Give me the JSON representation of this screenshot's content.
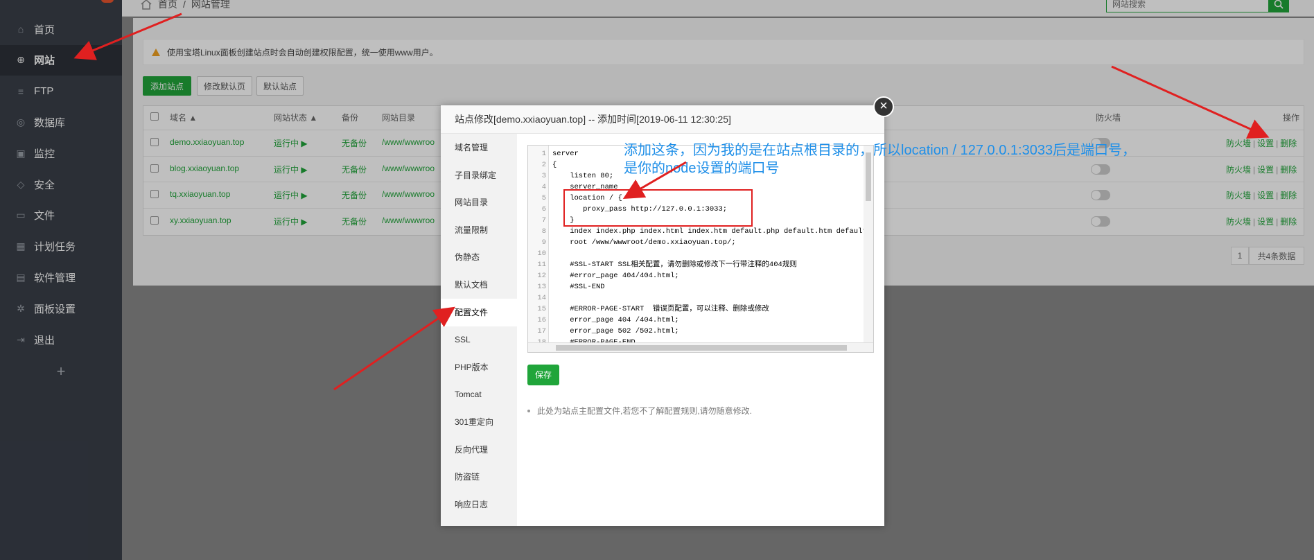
{
  "sidebar": {
    "items": [
      {
        "label": "首页",
        "icon": "home-icon"
      },
      {
        "label": "网站",
        "icon": "globe-icon"
      },
      {
        "label": "FTP",
        "icon": "ftp-icon"
      },
      {
        "label": "数据库",
        "icon": "database-icon"
      },
      {
        "label": "监控",
        "icon": "monitor-icon"
      },
      {
        "label": "安全",
        "icon": "shield-icon"
      },
      {
        "label": "文件",
        "icon": "folder-icon"
      },
      {
        "label": "计划任务",
        "icon": "calendar-icon"
      },
      {
        "label": "软件管理",
        "icon": "apps-icon"
      },
      {
        "label": "面板设置",
        "icon": "gear-icon"
      },
      {
        "label": "退出",
        "icon": "logout-icon"
      }
    ],
    "add_label": "+"
  },
  "breadcrumb": {
    "home": "首页",
    "sep": "/",
    "current": "网站管理"
  },
  "search": {
    "placeholder": "网站搜索"
  },
  "alert": {
    "text": "使用宝塔Linux面板创建站点时会自动创建权限配置，统一使用www用户。"
  },
  "toolbar": {
    "add_site": "添加站点",
    "edit_default": "修改默认页",
    "default_site": "默认站点"
  },
  "table": {
    "headers": {
      "domain": "域名 ▲",
      "status": "网站状态 ▲",
      "backup": "备份",
      "dir": "网站目录",
      "firewall": "防火墙",
      "ops": "操作"
    },
    "rows": [
      {
        "domain": "demo.xxiaoyuan.top",
        "status": "运行中 ▶",
        "backup": "无备份",
        "dir": "/www/wwwroo"
      },
      {
        "domain": "blog.xxiaoyuan.top",
        "status": "运行中 ▶",
        "backup": "无备份",
        "dir": "/www/wwwroo"
      },
      {
        "domain": "tq.xxiaoyuan.top",
        "status": "运行中 ▶",
        "backup": "无备份",
        "dir": "/www/wwwroo"
      },
      {
        "domain": "xy.xxiaoyuan.top",
        "status": "运行中 ▶",
        "backup": "无备份",
        "dir": "/www/wwwroo"
      }
    ],
    "ops": {
      "firewall": "防火墙",
      "settings": "设置",
      "delete": "删除",
      "sep": "|"
    }
  },
  "pagination": {
    "page": "1",
    "total": "共4条数据"
  },
  "modal": {
    "title": "站点修改[demo.xxiaoyuan.top] -- 添加时间[2019-06-11 12:30:25]",
    "close": "×",
    "nav": [
      "域名管理",
      "子目录绑定",
      "网站目录",
      "流量限制",
      "伪静态",
      "默认文档",
      "配置文件",
      "SSL",
      "PHP版本",
      "Tomcat",
      "301重定向",
      "反向代理",
      "防盗链",
      "响应日志"
    ],
    "active_nav": "配置文件",
    "save_label": "保存",
    "note": "此处为站点主配置文件,若您不了解配置规则,请勿随意修改."
  },
  "editor": {
    "lines": [
      {
        "n": "1",
        "text": "server"
      },
      {
        "n": "2",
        "text": "{"
      },
      {
        "n": "3",
        "text": "    listen 80;"
      },
      {
        "n": "4",
        "text": "    server_name"
      },
      {
        "n": "5",
        "text": "    location / {"
      },
      {
        "n": "6",
        "text": "       proxy_pass http://127.0.0.1:3033;"
      },
      {
        "n": "7",
        "text": "    }"
      },
      {
        "n": "8",
        "text": "    index index.php index.html index.htm default.php default.htm default.ht"
      },
      {
        "n": "9",
        "text": "    root /www/wwwroot/demo.xxiaoyuan.top/;"
      },
      {
        "n": "10",
        "text": ""
      },
      {
        "n": "11",
        "text": "    #SSL-START SSL相关配置，请勿删除或修改下一行带注释的404规则"
      },
      {
        "n": "12",
        "text": "    #error_page 404/404.html;"
      },
      {
        "n": "13",
        "text": "    #SSL-END"
      },
      {
        "n": "14",
        "text": ""
      },
      {
        "n": "15",
        "text": "    #ERROR-PAGE-START  错误页配置，可以注释、删除或修改"
      },
      {
        "n": "16",
        "text": "    error_page 404 /404.html;"
      },
      {
        "n": "17",
        "text": "    error_page 502 /502.html;"
      },
      {
        "n": "18",
        "text": "    #ERROR-PAGE-END"
      }
    ]
  },
  "annotation": {
    "line1": "添加这条，因为我的是在站点根目录的，所以location / 127.0.0.1:3033后是端口号，",
    "line2": "是你的node设置的端口号"
  },
  "colors": {
    "accent": "#20a53a",
    "annotation": "#1f8fe8",
    "highlight": "#e02020",
    "sidebar": "#3a3f49"
  }
}
